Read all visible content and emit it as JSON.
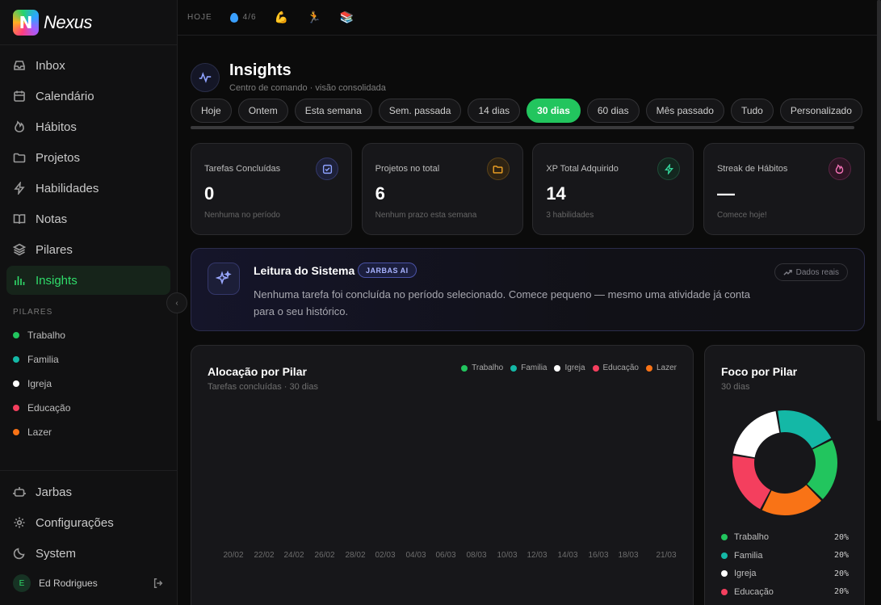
{
  "brand": {
    "name": "Nexus",
    "logo_letter": "N"
  },
  "nav": [
    {
      "id": "inbox",
      "label": "Inbox",
      "icon": "inbox-icon",
      "active": false
    },
    {
      "id": "calendario",
      "label": "Calendário",
      "icon": "calendar-icon",
      "active": false
    },
    {
      "id": "habitos",
      "label": "Hábitos",
      "icon": "flame-icon",
      "active": false
    },
    {
      "id": "projetos",
      "label": "Projetos",
      "icon": "folder-icon",
      "active": false
    },
    {
      "id": "habilidades",
      "label": "Habilidades",
      "icon": "bolt-icon",
      "active": false
    },
    {
      "id": "notas",
      "label": "Notas",
      "icon": "book-icon",
      "active": false
    },
    {
      "id": "pilares",
      "label": "Pilares",
      "icon": "layers-icon",
      "active": false
    },
    {
      "id": "insights",
      "label": "Insights",
      "icon": "bar-chart-icon",
      "active": true
    }
  ],
  "pillars": {
    "title": "PILARES",
    "items": [
      {
        "label": "Trabalho",
        "color": "#22c55e"
      },
      {
        "label": "Familia",
        "color": "#14b8a6"
      },
      {
        "label": "Igreja",
        "color": "#ffffff"
      },
      {
        "label": "Educação",
        "color": "#f43f5e"
      },
      {
        "label": "Lazer",
        "color": "#f97316"
      }
    ]
  },
  "sidebar_bottom": [
    {
      "id": "jarbas",
      "label": "Jarbas",
      "icon": "robot-icon"
    },
    {
      "id": "config",
      "label": "Configurações",
      "icon": "gear-icon"
    },
    {
      "id": "system",
      "label": "System",
      "icon": "moon-icon"
    }
  ],
  "user": {
    "name": "Ed Rodrigues",
    "initial": "E"
  },
  "topbar": {
    "today_label": "HOJE",
    "water": "4/6",
    "emojis": [
      "💪",
      "🏃",
      "📚"
    ]
  },
  "header": {
    "title": "Insights",
    "subtitle": "Centro de comando · visão consolidada"
  },
  "filters": [
    {
      "label": "Hoje",
      "active": false
    },
    {
      "label": "Ontem",
      "active": false
    },
    {
      "label": "Esta semana",
      "active": false
    },
    {
      "label": "Sem. passada",
      "active": false
    },
    {
      "label": "14 dias",
      "active": false
    },
    {
      "label": "30 dias",
      "active": true
    },
    {
      "label": "60 dias",
      "active": false
    },
    {
      "label": "Mês passado",
      "active": false
    },
    {
      "label": "Tudo",
      "active": false
    },
    {
      "label": "Personalizado",
      "active": false
    }
  ],
  "stats": [
    {
      "label": "Tarefas Concluídas",
      "value": "0",
      "sub": "Nenhuma no período",
      "icon": "check-square-icon",
      "color": "#8ea2ff",
      "bg": "#1d2038",
      "border": "#33386a"
    },
    {
      "label": "Projetos no total",
      "value": "6",
      "sub": "Nenhum prazo esta semana",
      "icon": "folder-icon",
      "color": "#f5a524",
      "bg": "#2e2313",
      "border": "#5a4219"
    },
    {
      "label": "XP Total Adquirido",
      "value": "14",
      "sub": "3 habilidades",
      "icon": "bolt-icon",
      "color": "#34d399",
      "bg": "#13271f",
      "border": "#1f4a37"
    },
    {
      "label": "Streak de Hábitos",
      "value": "—",
      "sub": "Comece hoje!",
      "icon": "flame-icon",
      "color": "#f472b6",
      "bg": "#2e1524",
      "border": "#5a2444"
    }
  ],
  "reading": {
    "title": "Leitura do Sistema",
    "badge": "JARBAS AI",
    "text": "Nenhuma tarefa foi concluída no período selecionado. Comece pequeno — mesmo uma atividade já conta para o seu histórico.",
    "real_label": "Dados reais"
  },
  "allocation": {
    "title": "Alocação por Pilar",
    "subtitle": "Tarefas concluídas · 30 dias"
  },
  "focus": {
    "title": "Foco por Pilar",
    "subtitle": "30 dias"
  },
  "chart_data": [
    {
      "type": "bar",
      "title": "Alocação por Pilar",
      "subtitle": "Tarefas concluídas · 30 dias",
      "categories": [
        "20/02",
        "22/02",
        "24/02",
        "26/02",
        "28/02",
        "02/03",
        "04/03",
        "06/03",
        "08/03",
        "10/03",
        "12/03",
        "14/03",
        "16/03",
        "18/03",
        "21/03"
      ],
      "series": [
        {
          "name": "Trabalho",
          "color": "#22c55e",
          "values": [
            0,
            0,
            0,
            0,
            0,
            0,
            0,
            0,
            0,
            0,
            0,
            0,
            0,
            0,
            0
          ]
        },
        {
          "name": "Familia",
          "color": "#14b8a6",
          "values": [
            0,
            0,
            0,
            0,
            0,
            0,
            0,
            0,
            0,
            0,
            0,
            0,
            0,
            0,
            0
          ]
        },
        {
          "name": "Igreja",
          "color": "#ffffff",
          "values": [
            0,
            0,
            0,
            0,
            0,
            0,
            0,
            0,
            0,
            0,
            0,
            0,
            0,
            0,
            0
          ]
        },
        {
          "name": "Educação",
          "color": "#f43f5e",
          "values": [
            0,
            0,
            0,
            0,
            0,
            0,
            0,
            0,
            0,
            0,
            0,
            0,
            0,
            0,
            0
          ]
        },
        {
          "name": "Lazer",
          "color": "#f97316",
          "values": [
            0,
            0,
            0,
            0,
            0,
            0,
            0,
            0,
            0,
            0,
            0,
            0,
            0,
            0,
            0
          ]
        }
      ],
      "legend": "top-right",
      "grid": false
    },
    {
      "type": "pie",
      "title": "Foco por Pilar",
      "subtitle": "30 dias",
      "donut": true,
      "start": "Educação at bottom",
      "slices": [
        {
          "name": "Trabalho",
          "value": 20,
          "label": "20%",
          "color": "#22c55e"
        },
        {
          "name": "Lazer",
          "value": 20,
          "label": "20%",
          "color": "#f97316"
        },
        {
          "name": "Educação",
          "value": 20,
          "label": "20%",
          "color": "#f43f5e"
        },
        {
          "name": "Igreja",
          "value": 20,
          "label": "20%",
          "color": "#ffffff"
        },
        {
          "name": "Familia",
          "value": 20,
          "label": "20%",
          "color": "#14b8a6"
        }
      ],
      "legend_order": [
        "Trabalho",
        "Familia",
        "Igreja",
        "Educação",
        "Lazer"
      ]
    }
  ]
}
